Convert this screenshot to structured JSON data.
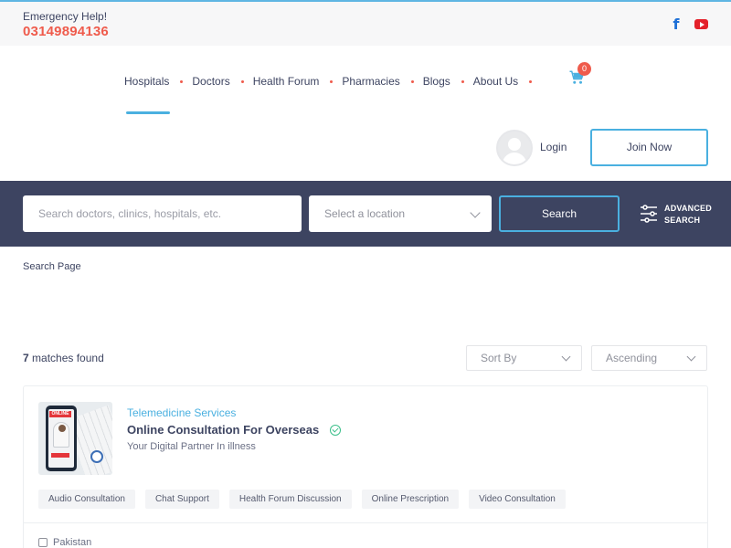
{
  "topbar": {
    "help_label": "Emergency Help!",
    "phone": "03149894136",
    "facebook_icon": "facebook-icon",
    "youtube_icon": "youtube-icon"
  },
  "nav": {
    "items": [
      {
        "label": "Hospitals",
        "active": true
      },
      {
        "label": "Doctors"
      },
      {
        "label": "Health Forum"
      },
      {
        "label": "Pharmacies"
      },
      {
        "label": "Blogs"
      },
      {
        "label": "About Us"
      }
    ],
    "cart_count": "0",
    "cart_icon": "cart-icon"
  },
  "auth": {
    "login_label": "Login",
    "join_label": "Join Now"
  },
  "search": {
    "placeholder": "Search doctors, clinics, hospitals, etc.",
    "location_placeholder": "Select a location",
    "button_label": "Search",
    "advanced_line1": "ADVANCED",
    "advanced_line2": "SEARCH"
  },
  "page": {
    "label": "Search Page"
  },
  "results": {
    "count": "7",
    "count_suffix": "matches found",
    "sort_label": "Sort By",
    "order_label": "Ascending"
  },
  "card": {
    "category": "Telemedicine Services",
    "title": "Online Consultation For Overseas",
    "subtitle": "Your Digital Partner In illness",
    "thumb_tag": "ONLINE",
    "tags": [
      "Audio Consultation",
      "Chat Support",
      "Health Forum Discussion",
      "Online Prescription",
      "Video Consultation"
    ],
    "location": "Pakistan"
  },
  "colors": {
    "accent": "#4ab0e0",
    "navy": "#3d4461",
    "alert": "#ef5b4c"
  }
}
